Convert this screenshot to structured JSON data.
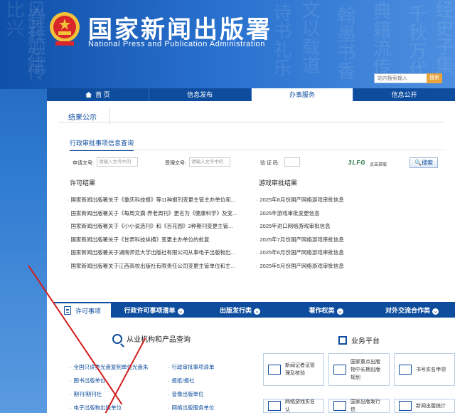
{
  "header": {
    "title": "国家新闻出版署",
    "subtitle": "National  Press and Publication Administration",
    "search_placeholder": "站内搜索输入",
    "search_button": "搜索"
  },
  "nav": [
    {
      "label": "首 页",
      "active": false
    },
    {
      "label": "信息发布",
      "active": false
    },
    {
      "label": "办事服务",
      "active": true
    },
    {
      "label": "信息公开",
      "active": false
    }
  ],
  "result": {
    "heading": "结果公示",
    "query_tab": "行政审批事项信息查询",
    "fields": {
      "apply_label": "申请文号:",
      "apply_placeholder": "请输入文号中的",
      "accept_label": "受理文号:",
      "accept_placeholder": "请输入文号中的",
      "captcha_label": "验 证 码:",
      "captcha_text": "3LFG",
      "captcha_refresh": "点击获取",
      "search_button": "搜索"
    }
  },
  "permit": {
    "title": "许可结果",
    "items": [
      "国家新闻出版署关于《重庆科技报》等11种报刊变更主管主办单位和...",
      "国家新闻出版署关于《每周文摘·养老周刊》更名为《健康科学》及变...",
      "国家新闻出版署关于《小小说选刊》和《百花园》2种期刊变更主管...",
      "国家新闻出版署关于《甘肃科技纵横》变更主办单位的批复",
      "国家新闻出版署关于湖南师范大学出版社有限公司从事电子出版物出...",
      "国家新闻出版署关于江西高校出版社有限责任公司变更主管单位和主..."
    ]
  },
  "game": {
    "title": "游戏审批结果",
    "items": [
      "2025年8月份国产网络游戏审批信息",
      "2025年游戏审批变更信息",
      "2025年进口网络游戏审批信息",
      "2025年7月份国产网络游戏审批信息",
      "2025年6月份国产网络游戏审批信息",
      "2025年5月份国产网络游戏审批信息"
    ]
  },
  "tabs": {
    "first": "许可事项",
    "items": [
      "行政许可事项清单",
      "出版发行类",
      "著作权类",
      "对外交流合作类"
    ]
  },
  "query": {
    "title": "从业机构和产品查询",
    "left_links": [
      "全国只读类光盘复制单位光盘朱",
      "图书出版单位",
      "期刊/期刊社",
      "电子出版物出版单位"
    ],
    "right_links": [
      "行政审批事项清单",
      "报纸/报社",
      "音像出版单位",
      "网络出版服务单位"
    ]
  },
  "platform": {
    "title": "业务平台",
    "cards": [
      "新闻记者证管理及核验",
      "国家重点出版物中长期出版规划",
      "书号实名申领",
      "网络游戏实名认",
      "国家出版发行信",
      "新闻出版统计"
    ]
  },
  "colors": {
    "primary": "#0e4d9e",
    "annotation_arrow": "#d21e1e"
  }
}
